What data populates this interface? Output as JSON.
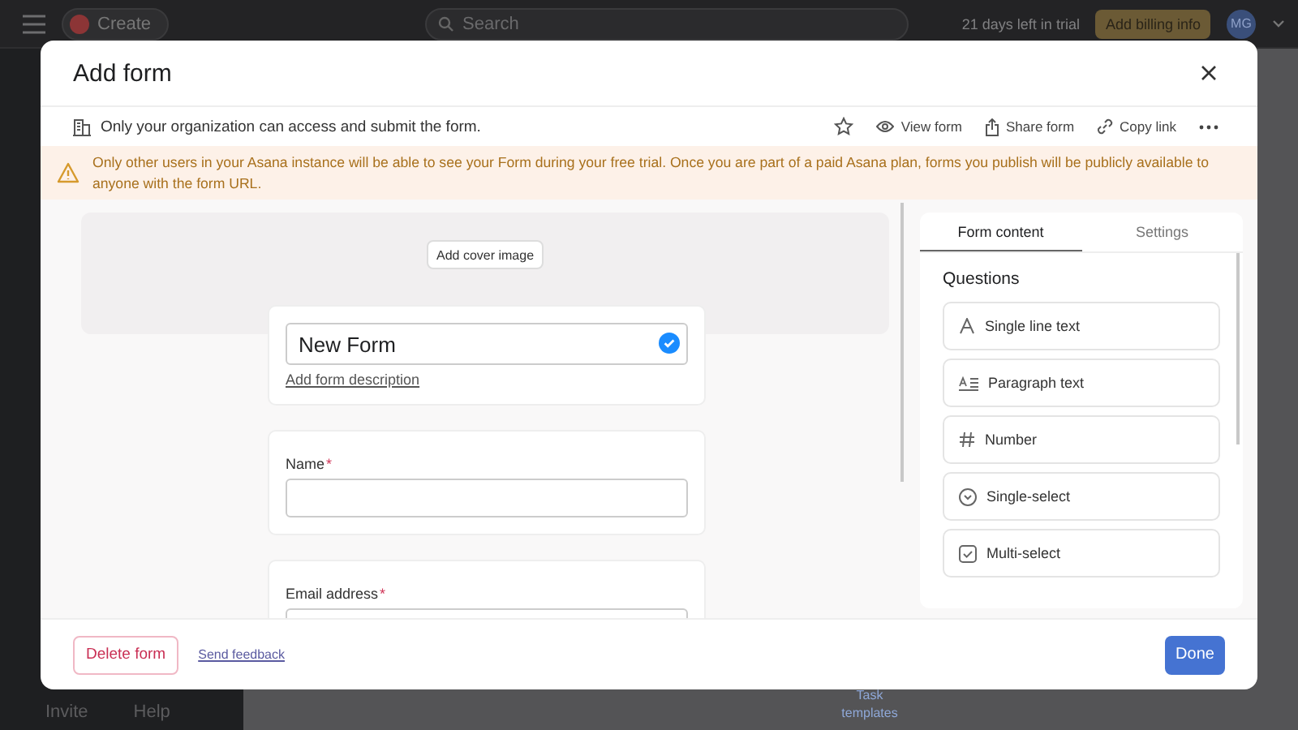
{
  "app_bar": {
    "create_label": "Create",
    "search_placeholder": "Search",
    "trial_text": "21 days left in trial",
    "billing_button": "Add billing info",
    "avatar_initials": "MG"
  },
  "sidebar_footer": {
    "invite": "Invite",
    "help": "Help"
  },
  "background_text": "Task templates",
  "modal": {
    "title": "Add form",
    "access_text": "Only your organization can access and submit the form.",
    "actions": [
      {
        "kind": "star"
      },
      {
        "kind": "view",
        "label": "View form"
      },
      {
        "kind": "share",
        "label": "Share form"
      },
      {
        "kind": "link",
        "label": "Copy link"
      },
      {
        "kind": "more"
      }
    ],
    "banner": "Only other users in your Asana instance will be able to see your Form during your free trial. Once you are part of a paid Asana plan, forms you publish will be publicly available to anyone with the form URL.",
    "cover_button": "Add cover image",
    "form_title": "New Form",
    "description_link": "Add form description",
    "fields": [
      {
        "label": "Name",
        "required_mark": "*"
      },
      {
        "label": "Email address",
        "required_mark": "*"
      }
    ],
    "tabs": [
      {
        "label": "Form content",
        "selected": true
      },
      {
        "label": "Settings",
        "selected": false
      }
    ],
    "questions_heading": "Questions",
    "question_types": [
      {
        "kind": "single_line",
        "label": "Single line text"
      },
      {
        "kind": "paragraph",
        "label": "Paragraph text"
      },
      {
        "kind": "number",
        "label": "Number"
      },
      {
        "kind": "single_select",
        "label": "Single-select"
      },
      {
        "kind": "multi_select",
        "label": "Multi-select"
      }
    ],
    "delete_button": "Delete form",
    "feedback_link": "Send feedback",
    "done_button": "Done"
  }
}
